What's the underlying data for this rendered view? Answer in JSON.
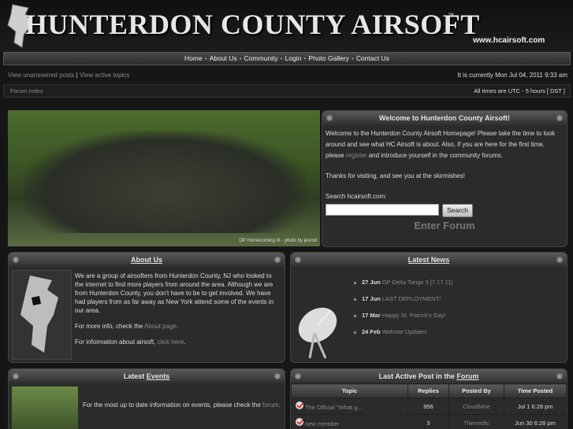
{
  "header": {
    "title": "HUNTERDON COUNTY AIRSOFT",
    "tm": "™",
    "url": "www.hcairsoft.com"
  },
  "nav": [
    "Home",
    "About Us",
    "Community",
    "Login",
    "Photo Gallery",
    "Contact Us"
  ],
  "nav_sep": "•",
  "subbar": {
    "unanswered": "View unanswered posts",
    "divider": "|",
    "active": "View active topics",
    "current_time": "It is currently Mon Jul 04, 2011 9:33 am",
    "forum_index": "Forum index",
    "timezone": "All times are UTC - 5 hours [ DST ]"
  },
  "photo_caption": "OP Homecoming III - photo by jesrod",
  "welcome": {
    "title": "Welcome to Hunterdon County Airsoft!",
    "p1_a": "Welcome to the Hunterdon County Airsoft Homepage! Please take the time to look around and see what HC Airsoft is about. Also, if you are here for the first time, please ",
    "p1_link": "register",
    "p1_b": " and introduce yourself in the community forums.",
    "p2": "Thanks for visiting, and see you at the skirmishes!",
    "search_label": "Search hcairsoft.com:",
    "search_button": "Search",
    "enter_forum": "Enter Forum"
  },
  "about": {
    "title": "About Us",
    "p1": "We are a group of airsofters from Hunterdon County, NJ who looked to the internet to find more players from around the area. Although we are from Hunterdon County, you don't have to be to get involved. We have had players from as far away as New York attend some of the events in our area.",
    "p2_a": "For more info, check the ",
    "p2_link": "About page",
    "p2_b": ".",
    "p3_a": "For information about airsoft, ",
    "p3_link": "click here",
    "p3_b": "."
  },
  "news": {
    "title": "Latest News",
    "items": [
      {
        "date": "27 Jun",
        "text": "OP Delta Tango 3 [7.17.11]"
      },
      {
        "date": "17 Jun",
        "text": "LAST DEPLOYMENT!"
      },
      {
        "date": "17 Mar",
        "text": "Happy St. Patrick's Day!"
      },
      {
        "date": "24 Feb",
        "text": "Website Updates"
      }
    ]
  },
  "events": {
    "title_a": "Latest ",
    "title_link": "Events",
    "text_a": "For the most up to date information on events, please check the ",
    "text_link": "forum",
    "text_b": "."
  },
  "active": {
    "title_a": "Last Active Post in the ",
    "title_link": "Forum",
    "columns": [
      "Topic",
      "Replies",
      "Posted By",
      "Time Posted"
    ],
    "rows": [
      {
        "topic": "The Official \"What g...",
        "replies": "956",
        "by": "CloudNine",
        "time": "Jul 1 6:28 pm"
      },
      {
        "topic": "new member",
        "replies": "3",
        "by": "Themedic",
        "time": "Jun 30 6:28 pm"
      }
    ]
  }
}
